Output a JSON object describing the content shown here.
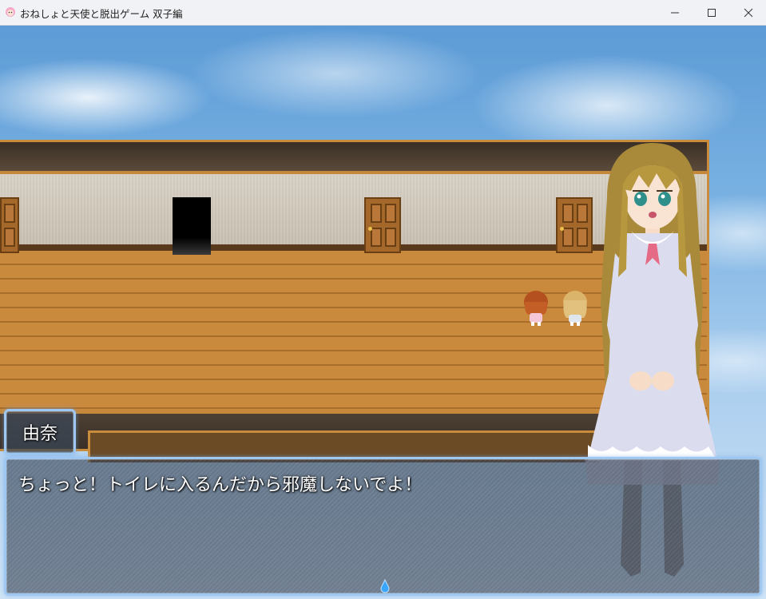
{
  "window": {
    "title": "おねしょと天使と脱出ゲーム 双子編",
    "icon": "pink-hair-app-icon",
    "controls": [
      "minimize-icon",
      "maximize-icon",
      "close-icon"
    ]
  },
  "scene": {
    "location": "hallway",
    "doors": [
      "door-left",
      "doorway-dark",
      "door-middle",
      "door-right"
    ],
    "map_characters": [
      "red-hair-girl",
      "blonde-hair-girl"
    ]
  },
  "dialogue": {
    "speaker": "由奈",
    "message": "ちょっと！トイレに入るんだから邪魔しないでよ！"
  },
  "colors": {
    "window_border": "#9ec8f2",
    "text": "#ffffff",
    "floor": "#c98a3e",
    "frame": "#c98c3c"
  }
}
